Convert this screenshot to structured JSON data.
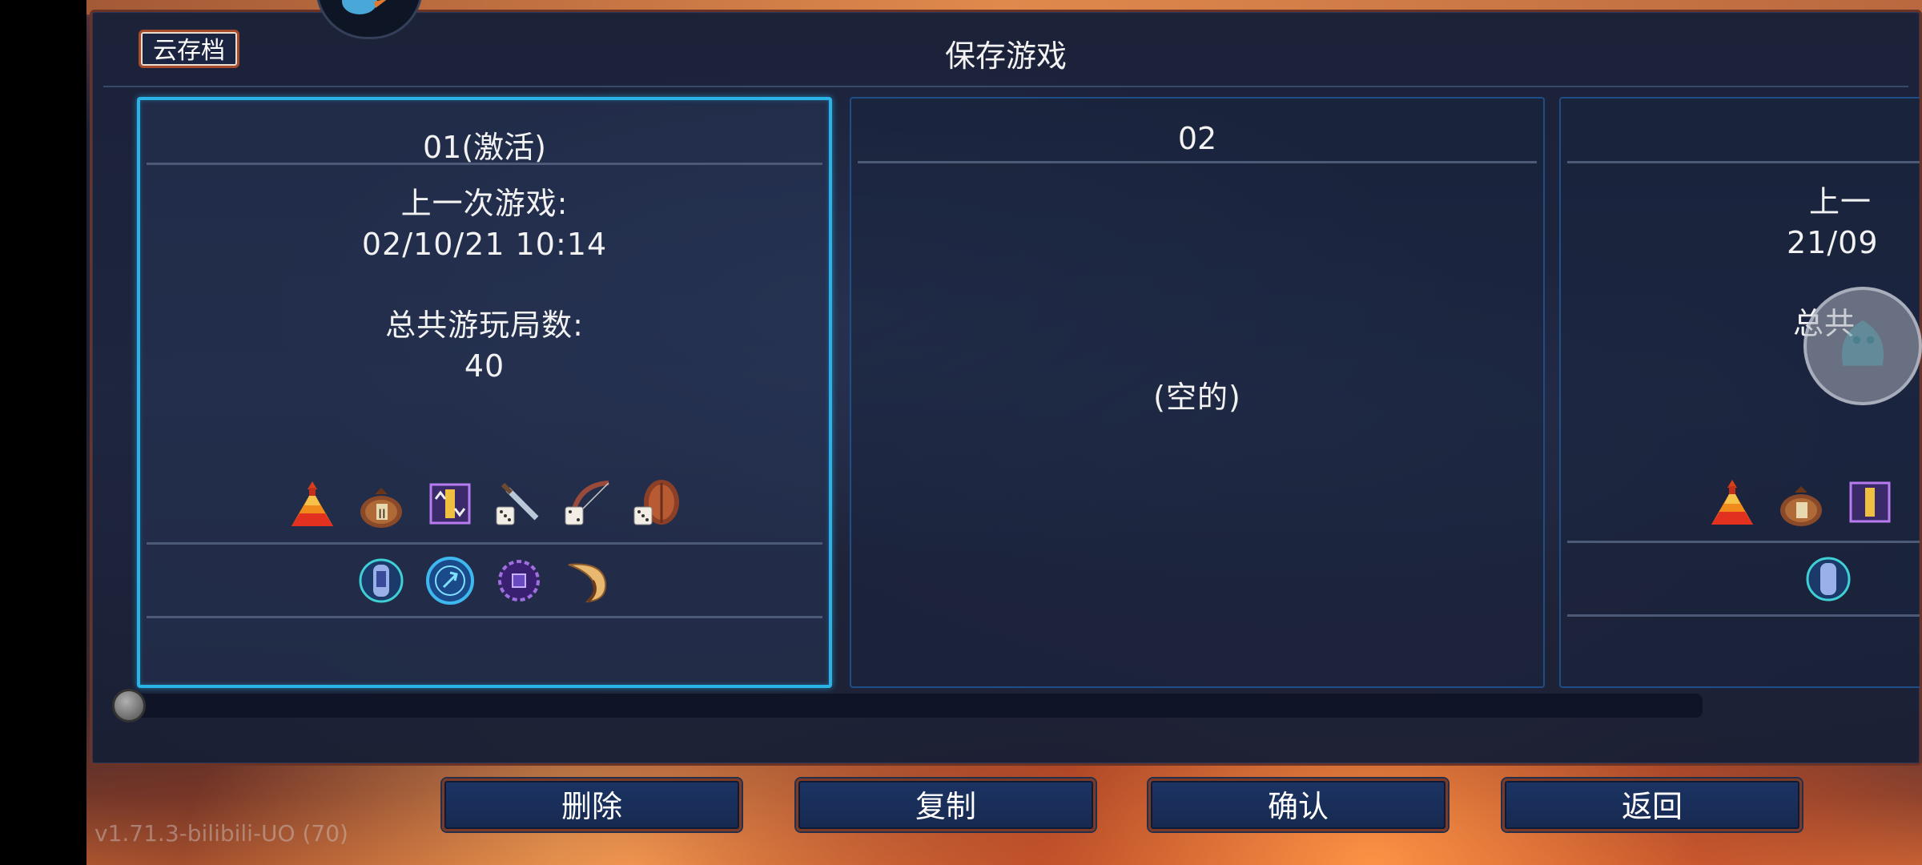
{
  "header": {
    "cloud_label": "云存档",
    "title": "保存游戏"
  },
  "slots": [
    {
      "title": "01(激活)",
      "last_played_label": "上一次游戏:",
      "last_played": "02/10/21 10:14",
      "total_runs_label": "总共游玩局数:",
      "total_runs": "40",
      "active": true,
      "icons_row1": [
        "potion-icon",
        "money-bag-icon",
        "scroll-rune-icon",
        "dice-sword-icon",
        "dice-bow-icon",
        "dice-shield-icon"
      ],
      "icons_row2": [
        "teleport-rune-icon",
        "blue-rune-icon",
        "purple-orb-icon",
        "horn-icon"
      ]
    },
    {
      "title": "02",
      "empty_label": "(空的)",
      "active": false
    },
    {
      "title": "",
      "last_played_label": "上一",
      "last_played": "21/09",
      "total_runs_label": "总共",
      "active": false
    }
  ],
  "buttons": {
    "delete": "删除",
    "copy": "复制",
    "confirm": "确认",
    "back": "返回"
  },
  "version": "v1.71.3-bilibili-UO (70)",
  "slider": {
    "position": 0
  },
  "colors": {
    "active_border": "#2ab3e6",
    "slot_border": "#1f4d86",
    "button_bg": "#1c3464",
    "button_border": "#7b3a28"
  }
}
